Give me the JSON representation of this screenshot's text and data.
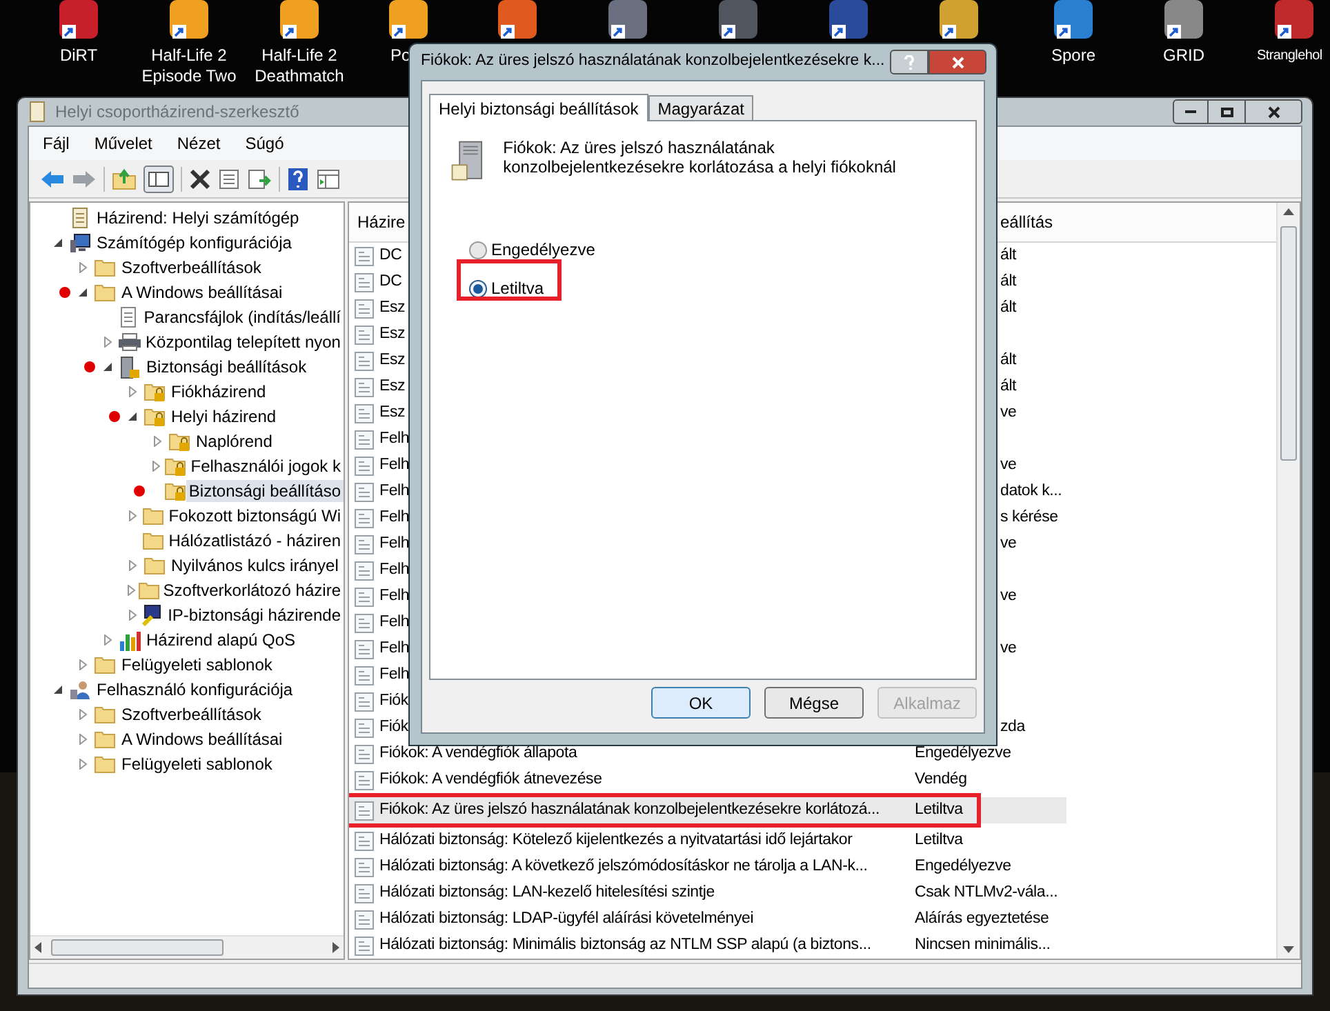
{
  "desktop_icons": [
    {
      "label": "DiRT"
    },
    {
      "label": "Half-Life 2 Episode Two"
    },
    {
      "label": "Half-Life 2 Deathmatch"
    },
    {
      "label": "Po"
    },
    {
      "label": "Spore"
    },
    {
      "label": "GRID"
    },
    {
      "label": "Stranglehol"
    }
  ],
  "window": {
    "title": "Helyi csoportházirend-szerkesztő",
    "menu": [
      "Fájl",
      "Művelet",
      "Nézet",
      "Súgó"
    ],
    "tree": [
      {
        "label": "Házirend: Helyi számítógép",
        "kind": "scroll",
        "marked": false,
        "selected": false
      },
      {
        "label": "Számítógép konfigurációja",
        "kind": "computer",
        "expanded": true,
        "marked": false,
        "selected": false,
        "children": [
          {
            "label": "Szoftverbeállítások",
            "kind": "folder",
            "expanded": false,
            "marked": false,
            "selected": false
          },
          {
            "label": "A Windows beállításai",
            "kind": "folder",
            "expanded": true,
            "marked": true,
            "selected": false,
            "children": [
              {
                "label": "Parancsfájlok (indítás/leállí",
                "kind": "script",
                "marked": false,
                "selected": false
              },
              {
                "label": "Központilag telepített nyon",
                "kind": "printer",
                "expanded": false,
                "marked": false,
                "selected": false
              },
              {
                "label": "Biztonsági beállítások",
                "kind": "server",
                "expanded": true,
                "marked": true,
                "selected": false,
                "children": [
                  {
                    "label": "Fiókházirend",
                    "kind": "lockfolder",
                    "expanded": false,
                    "marked": false,
                    "selected": false
                  },
                  {
                    "label": "Helyi házirend",
                    "kind": "lockfolder",
                    "expanded": true,
                    "marked": true,
                    "selected": false,
                    "children": [
                      {
                        "label": "Naplórend",
                        "kind": "lockfolder",
                        "expanded": false,
                        "marked": false,
                        "selected": false
                      },
                      {
                        "label": "Felhasználói jogok k",
                        "kind": "lockfolder",
                        "expanded": false,
                        "marked": false,
                        "selected": false
                      },
                      {
                        "label": "Biztonsági beállításo",
                        "kind": "lockfolder",
                        "marked": true,
                        "selected": true
                      }
                    ]
                  },
                  {
                    "label": "Fokozott biztonságú Wi",
                    "kind": "folder",
                    "expanded": false,
                    "marked": false,
                    "selected": false
                  },
                  {
                    "label": "Hálózatlistázó - háziren",
                    "kind": "folder",
                    "marked": false,
                    "selected": false
                  },
                  {
                    "label": "Nyilvános kulcs irányel",
                    "kind": "folder",
                    "expanded": false,
                    "marked": false,
                    "selected": false
                  },
                  {
                    "label": "Szoftverkorlátozó házire",
                    "kind": "folder",
                    "expanded": false,
                    "marked": false,
                    "selected": false
                  },
                  {
                    "label": "IP-biztonsági házirende",
                    "kind": "ip",
                    "expanded": false,
                    "marked": false,
                    "selected": false
                  }
                ]
              },
              {
                "label": "Házirend alapú QoS",
                "kind": "chart",
                "expanded": false,
                "marked": false,
                "selected": false
              }
            ]
          },
          {
            "label": "Felügyeleti sablonok",
            "kind": "folder",
            "expanded": false,
            "marked": false,
            "selected": false
          }
        ]
      },
      {
        "label": "Felhasználó konfigurációja",
        "kind": "user",
        "expanded": true,
        "marked": false,
        "selected": false,
        "children": [
          {
            "label": "Szoftverbeállítások",
            "kind": "folder",
            "expanded": false,
            "marked": false,
            "selected": false
          },
          {
            "label": "A Windows beállításai",
            "kind": "folder",
            "expanded": false,
            "marked": false,
            "selected": false
          },
          {
            "label": "Felügyeleti sablonok",
            "kind": "folder",
            "expanded": false,
            "marked": false,
            "selected": false
          }
        ]
      }
    ],
    "list": {
      "columns": [
        "Házire",
        "eállítás"
      ],
      "rows": [
        {
          "kind": "covered",
          "name": "DC",
          "setting": "ált",
          "selected": false
        },
        {
          "kind": "covered",
          "name": "DC",
          "setting": "ált",
          "selected": false
        },
        {
          "kind": "covered",
          "name": "Esz",
          "setting": "ált",
          "selected": false
        },
        {
          "kind": "covered",
          "name": "Esz",
          "selected": false
        },
        {
          "kind": "covered",
          "name": "Esz",
          "setting": "ált",
          "selected": false
        },
        {
          "kind": "covered",
          "name": "Esz",
          "setting": "ált",
          "selected": false
        },
        {
          "kind": "covered",
          "name": "Esz",
          "setting": "ve",
          "selected": false
        },
        {
          "kind": "covered",
          "name": "Felh",
          "selected": false
        },
        {
          "kind": "covered",
          "name": "Felh",
          "setting": "ve",
          "selected": false
        },
        {
          "kind": "covered",
          "name": "Felh",
          "setting": "datok k...",
          "selected": false
        },
        {
          "kind": "covered",
          "name": "Felh",
          "setting": "s kérése",
          "selected": false
        },
        {
          "kind": "covered",
          "name": "Felh",
          "setting": "ve",
          "selected": false
        },
        {
          "kind": "covered",
          "name": "Felh",
          "selected": false
        },
        {
          "kind": "covered",
          "name": "Felh",
          "setting": "ve",
          "selected": false
        },
        {
          "kind": "covered",
          "name": "Felh",
          "selected": false
        },
        {
          "kind": "covered",
          "name": "Felh",
          "setting": "ve",
          "selected": false
        },
        {
          "kind": "covered",
          "name": "Felh",
          "selected": false
        },
        {
          "kind": "covered",
          "name": "Fiók",
          "selected": false
        },
        {
          "kind": "covered",
          "name": "Fiók",
          "setting": "zda",
          "selected": false
        },
        {
          "kind": "full",
          "name": "Fiókok: A vendégfiók állapota",
          "setting": "Engedélyezve",
          "selected": false
        },
        {
          "kind": "full",
          "name": "Fiókok: A vendégfiók átnevezése",
          "setting": "Vendég",
          "selected": false
        },
        {
          "kind": "full",
          "name": "Fiókok: Az üres jelszó használatának konzolbejelentkezésekre korlátozá...",
          "setting": "Letiltva",
          "selected": true
        },
        {
          "kind": "full",
          "name": "Hálózati biztonság: Kötelező kijelentkezés a nyitvatartási idő lejártakor",
          "setting": "Letiltva",
          "selected": false
        },
        {
          "kind": "full",
          "name": "Hálózati biztonság: A következő jelszómódosításkor ne tárolja a LAN-k...",
          "setting": "Engedélyezve",
          "selected": false
        },
        {
          "kind": "full",
          "name": "Hálózati biztonság: LAN-kezelő hitelesítési szintje",
          "setting": "Csak NTLMv2-vála...",
          "selected": false
        },
        {
          "kind": "full",
          "name": "Hálózati biztonság: LDAP-ügyfél aláírási követelményei",
          "setting": "Aláírás egyeztetése",
          "selected": false
        },
        {
          "kind": "full",
          "name": "Hálózati biztonság: Minimális biztonság az NTLM SSP alapú (a biztons...",
          "setting": "Nincsen minimális...",
          "selected": false
        }
      ]
    }
  },
  "dialog": {
    "title": "Fiókok: Az üres jelszó használatának konzolbejelentkezésekre k...",
    "tabs": [
      {
        "label": "Helyi biztonsági beállítások",
        "selected": true
      },
      {
        "label": "Magyarázat",
        "selected": false
      }
    ],
    "description": "Fiókok: Az üres jelszó használatának konzolbejelentkezésekre korlátozása a helyi fiókoknál",
    "options": [
      {
        "label": "Engedélyezve",
        "selected": false
      },
      {
        "label": "Letiltva",
        "selected": true
      }
    ],
    "buttons": [
      {
        "label": "OK",
        "kind": "default",
        "disabled": false
      },
      {
        "label": "Mégse",
        "kind": "normal",
        "disabled": false
      },
      {
        "label": "Alkalmaz",
        "kind": "normal",
        "disabled": true
      }
    ]
  }
}
